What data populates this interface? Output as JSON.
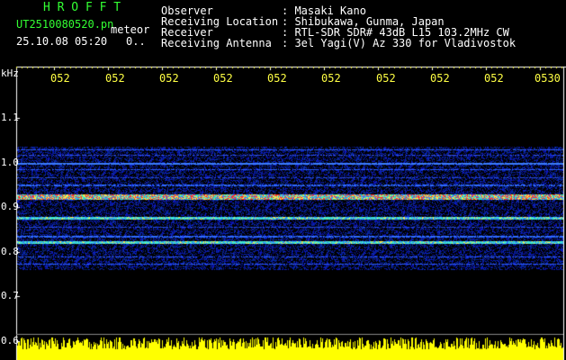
{
  "header": {
    "title": "H R O F F T",
    "filename": "UT2510080520.pn",
    "file_type": "meteor",
    "datetime": "25.10.08 05:20",
    "counter": "0.."
  },
  "info": {
    "labels": [
      "Observer",
      "Receiving Location",
      "Receiver",
      "Receiving Antenna"
    ],
    "values": [
      ": Masaki Kano",
      ": Shibukawa, Gunma, Japan",
      ": RTL-SDR SDR# 43dB L15 103.2MHz CW",
      ": 3el Yagi(V) Az 330 for Vladivostok"
    ]
  },
  "axis": {
    "unit": "kHz",
    "time_labels": [
      "052",
      "052",
      "052",
      "052",
      "052",
      "052",
      "052",
      "052",
      "052",
      "0530"
    ],
    "freq_labels": [
      "1.1",
      "1.0",
      "0.9",
      "0.8",
      "0.7",
      "0.6"
    ]
  },
  "colors": {
    "text_label": "#33ff33",
    "text_value": "#ffffff",
    "time_label": "#ffff44",
    "background": "#000000",
    "noise_floor": "#0a1e9c",
    "echo_line": "#ffff00"
  }
}
